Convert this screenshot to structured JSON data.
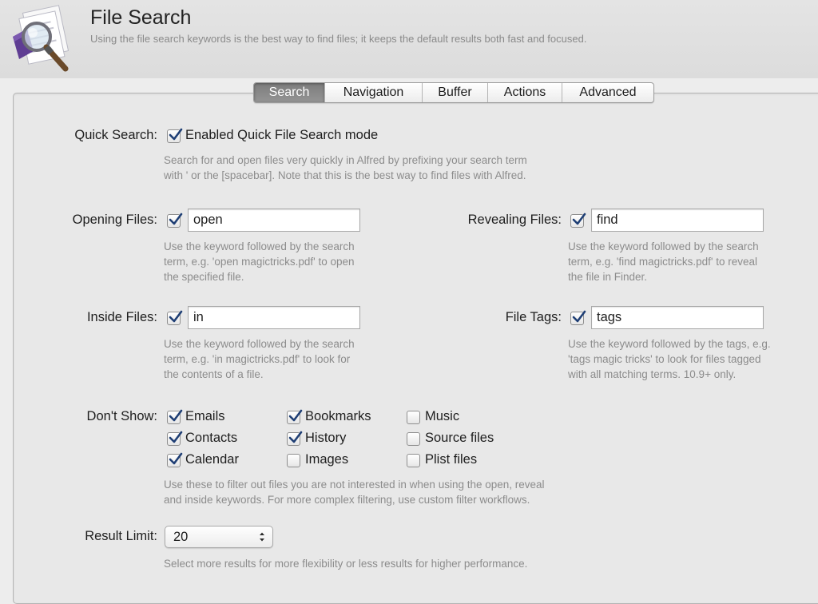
{
  "header": {
    "title": "File Search",
    "subtitle": "Using the file search keywords is the best way to find files; it keeps the default results both fast and focused."
  },
  "tabs": [
    {
      "label": "Search",
      "active": true
    },
    {
      "label": "Navigation",
      "active": false
    },
    {
      "label": "Buffer",
      "active": false
    },
    {
      "label": "Actions",
      "active": false
    },
    {
      "label": "Advanced",
      "active": false
    }
  ],
  "quick_search": {
    "label": "Quick Search:",
    "checkbox_label": "Enabled Quick File Search mode",
    "checked": true,
    "help": [
      "Search for and open files very quickly in Alfred by prefixing your search term",
      "with ' or the [spacebar]. Note that this is the best way to find files with Alfred."
    ]
  },
  "opening_files": {
    "label": "Opening Files:",
    "checked": true,
    "value": "open",
    "help": [
      "Use the keyword followed by the search",
      "term, e.g. 'open magictricks.pdf' to open",
      "the specified file."
    ]
  },
  "revealing_files": {
    "label": "Revealing Files:",
    "checked": true,
    "value": "find",
    "help": [
      "Use the keyword followed by the search",
      "term, e.g. 'find magictricks.pdf' to reveal",
      "the file in Finder."
    ]
  },
  "inside_files": {
    "label": "Inside Files:",
    "checked": true,
    "value": "in",
    "help": [
      "Use the keyword followed by the search",
      "term, e.g. 'in magictricks.pdf' to look for",
      "the contents of a file."
    ]
  },
  "file_tags": {
    "label": "File Tags:",
    "checked": true,
    "value": "tags",
    "help": [
      "Use the keyword followed by the tags, e.g.",
      "'tags magic tricks' to look for files tagged",
      "with all matching terms. 10.9+ only."
    ]
  },
  "dont_show": {
    "label": "Don't Show:",
    "options": [
      {
        "label": "Emails",
        "checked": true
      },
      {
        "label": "Contacts",
        "checked": true
      },
      {
        "label": "Calendar",
        "checked": true
      },
      {
        "label": "Bookmarks",
        "checked": true
      },
      {
        "label": "History",
        "checked": true
      },
      {
        "label": "Images",
        "checked": false
      },
      {
        "label": "Music",
        "checked": false
      },
      {
        "label": "Source files",
        "checked": false
      },
      {
        "label": "Plist files",
        "checked": false
      }
    ],
    "help": [
      "Use these to filter out files you are not interested in when using the open, reveal",
      "and inside keywords. For more complex filtering, use custom filter workflows."
    ]
  },
  "result_limit": {
    "label": "Result Limit:",
    "value": "20",
    "help": "Select more results for more flexibility or less results for higher performance."
  },
  "colors": {
    "checkmark": "#1f3f75",
    "active_tab": "#888888",
    "help_text": "#8c8c8c"
  }
}
